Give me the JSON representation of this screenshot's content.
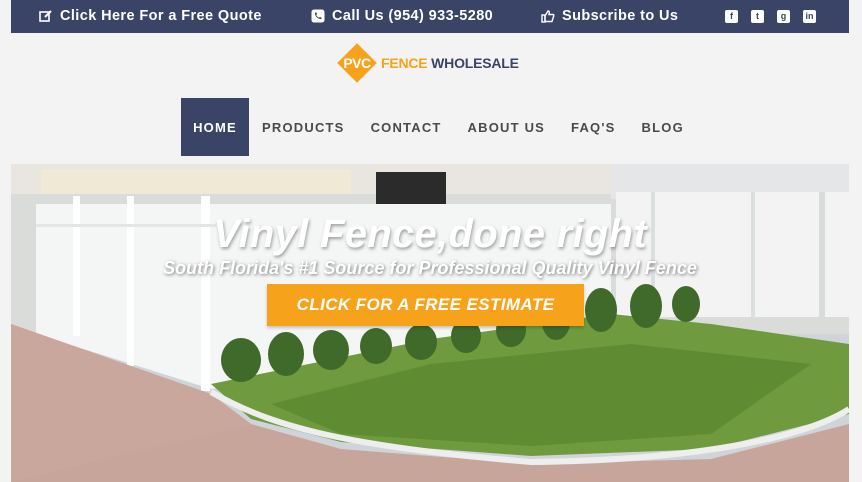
{
  "topbar": {
    "quote_label": "Click Here For a Free Quote",
    "call_label": "Call Us (954) 933-5280",
    "subscribe_label": "Subscribe to Us",
    "social": [
      {
        "name": "facebook-icon",
        "glyph": "f"
      },
      {
        "name": "twitter-icon",
        "glyph": "t"
      },
      {
        "name": "google-plus-icon",
        "glyph": "g"
      },
      {
        "name": "linkedin-icon",
        "glyph": "in"
      }
    ]
  },
  "logo": {
    "badge": "PVC",
    "word1": "FENCE",
    "word2": "WHOLESALE"
  },
  "nav": {
    "items": [
      {
        "label": "HOME",
        "active": true
      },
      {
        "label": "PRODUCTS"
      },
      {
        "label": "CONTACT"
      },
      {
        "label": "ABOUT US"
      },
      {
        "label": "FAQ'S"
      },
      {
        "label": "BLOG"
      }
    ]
  },
  "hero": {
    "title": "Vinyl Fence,done right",
    "subtitle": "South Florida's #1 Source for Professional Quality Vinyl Fence",
    "cta_label": "Click for a free estimate"
  },
  "colors": {
    "navy": "#3a4466",
    "orange": "#f7a21b"
  }
}
